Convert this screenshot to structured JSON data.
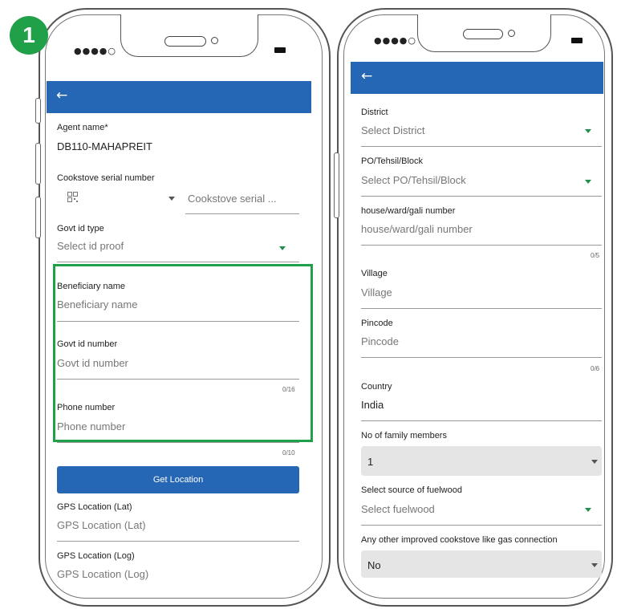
{
  "step_badge": "1",
  "phone1": {
    "status_signal": "●●●●○",
    "agent_name_label": "Agent name*",
    "agent_name_value": "DB110-MAHAPREIT",
    "serial_label": "Cookstove serial number",
    "serial_placeholder": "Cookstove serial ...",
    "govt_id_type_label": "Govt id type",
    "govt_id_type_placeholder": "Select id proof",
    "beneficiary_label": "Beneficiary name",
    "beneficiary_placeholder": "Beneficiary name",
    "govt_id_number_label": "Govt id number",
    "govt_id_number_placeholder": "Govt id number",
    "govt_id_counter": "0/16",
    "phone_label": "Phone number",
    "phone_placeholder": "Phone number",
    "phone_counter": "0/10",
    "get_location_button": "Get Location",
    "gps_lat_label": "GPS Location (Lat)",
    "gps_lat_placeholder": "GPS Location (Lat)",
    "gps_log_label": "GPS Location (Log)",
    "gps_log_placeholder": "GPS Location (Log)"
  },
  "phone2": {
    "status_signal": "●●●●○",
    "district_label": "District",
    "district_placeholder": "Select District",
    "po_label": "PO/Tehsil/Block",
    "po_placeholder": "Select PO/Tehsil/Block",
    "house_label": "house/ward/gali number",
    "house_placeholder": "house/ward/gali number",
    "house_counter": "0/5",
    "village_label": "Village",
    "village_placeholder": "Village",
    "pincode_label": "Pincode",
    "pincode_placeholder": "Pincode",
    "pincode_counter": "0/6",
    "country_label": "Country",
    "country_value": "India",
    "family_label": "No of family members",
    "family_value": "1",
    "fuelwood_label": "Select source of fuelwood",
    "fuelwood_placeholder": "Select fuelwood",
    "gas_label": "Any other improved cookstove like gas connection",
    "gas_value": "No"
  },
  "colors": {
    "appbar": "#2566b5",
    "highlight": "#21a04a",
    "accent_caret": "#1f8f4e"
  }
}
